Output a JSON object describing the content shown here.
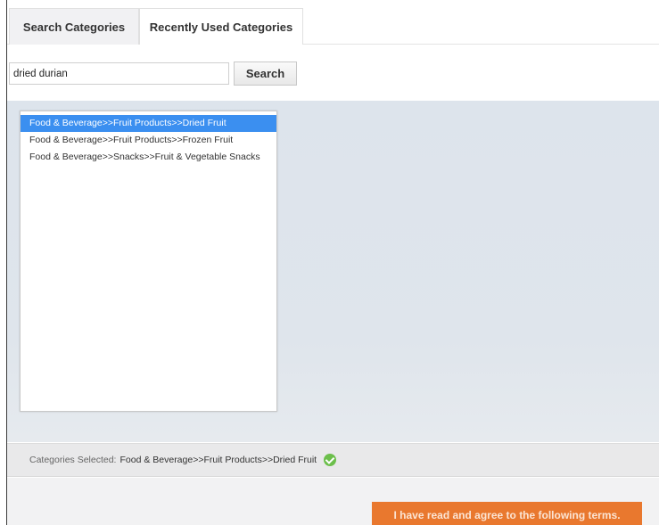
{
  "tabs": [
    {
      "label": "Search Categories",
      "active": true
    },
    {
      "label": "Recently Used Categories",
      "active": false
    }
  ],
  "search": {
    "value": "dried durian",
    "button_label": "Search"
  },
  "results": [
    {
      "label": "Food & Beverage>>Fruit Products>>Dried Fruit",
      "selected": true
    },
    {
      "label": "Food & Beverage>>Fruit Products>>Frozen Fruit",
      "selected": false
    },
    {
      "label": "Food & Beverage>>Snacks>>Fruit & Vegetable Snacks",
      "selected": false
    }
  ],
  "selection": {
    "label": "Categories Selected:",
    "value": "Food & Beverage>>Fruit Products>>Dried Fruit",
    "status_icon": "check-circle-icon"
  },
  "agree_button": {
    "label": "I have read and agree to the following terms."
  },
  "colors": {
    "accent_selected": "#3b8ff0",
    "agree_button": "#e9782e",
    "check_green": "#6cbf4b"
  }
}
